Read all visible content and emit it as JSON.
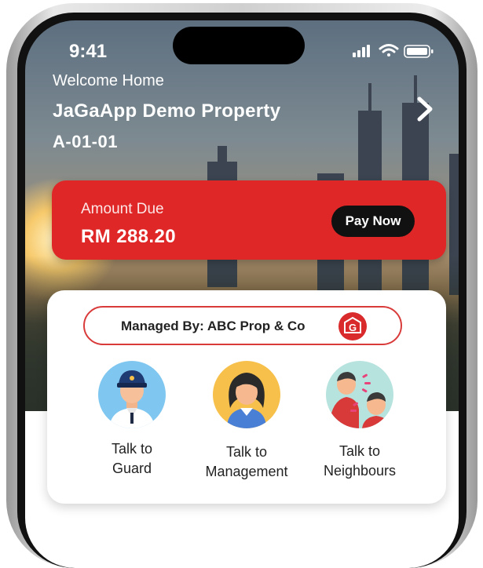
{
  "status_bar": {
    "time": "9:41"
  },
  "header": {
    "welcome": "Welcome Home",
    "property_name": "JaGaApp Demo Property",
    "unit": "A-01-01"
  },
  "amount_due": {
    "label": "Amount Due",
    "amount": "RM 288.20",
    "pay_button": "Pay Now"
  },
  "management": {
    "managed_by": "Managed By: ABC Prop & Co",
    "logo_letter": "G"
  },
  "actions": [
    {
      "label_line1": "Talk to",
      "label_line2": "Guard",
      "icon": "guard-avatar-icon"
    },
    {
      "label_line1": "Talk to",
      "label_line2": "Management",
      "icon": "management-avatar-icon"
    },
    {
      "label_line1": "Talk to",
      "label_line2": "Neighbours",
      "icon": "neighbours-avatar-icon"
    }
  ],
  "colors": {
    "accent_red": "#e02727",
    "pay_button_bg": "#111111",
    "guard_bg": "#7fc7f0",
    "management_bg": "#f7c04a",
    "neighbours_bg": "#b7e3df"
  }
}
